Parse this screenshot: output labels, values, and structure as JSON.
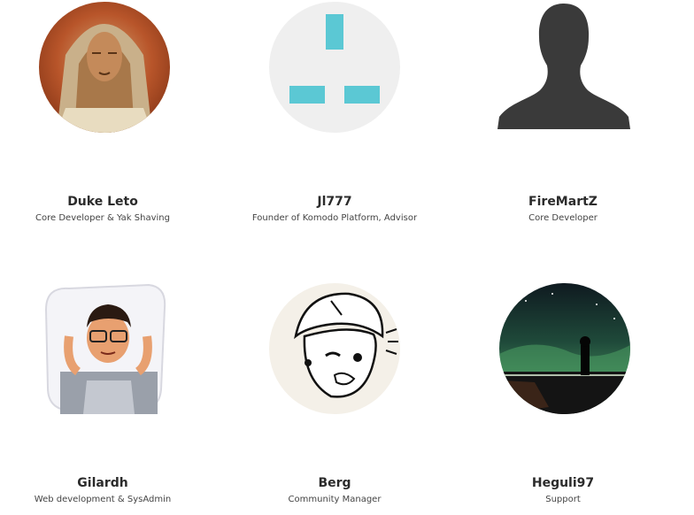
{
  "team": [
    {
      "name": "Duke Leto",
      "role": "Core Developer & Yak Shaving",
      "avatar_icon": "painted-portrait-avatar"
    },
    {
      "name": "Jl777",
      "role": "Founder of Komodo Platform, Advisor",
      "avatar_icon": "plug-shape-avatar"
    },
    {
      "name": "FireMartZ",
      "role": "Core Developer",
      "avatar_icon": "silhouette-avatar"
    },
    {
      "name": "Gilardh",
      "role": "Web development & SysAdmin",
      "avatar_icon": "bitmoji-relaxing-avatar"
    },
    {
      "name": "Berg",
      "role": "Community Manager",
      "avatar_icon": "cartoon-winking-avatar"
    },
    {
      "name": "Heguli97",
      "role": "Support",
      "avatar_icon": "aurora-night-avatar"
    }
  ],
  "colors": {
    "plug_accent": "#5bc8d4",
    "silhouette": "#3a3a3a",
    "avatar_bg_light": "#efefef"
  }
}
